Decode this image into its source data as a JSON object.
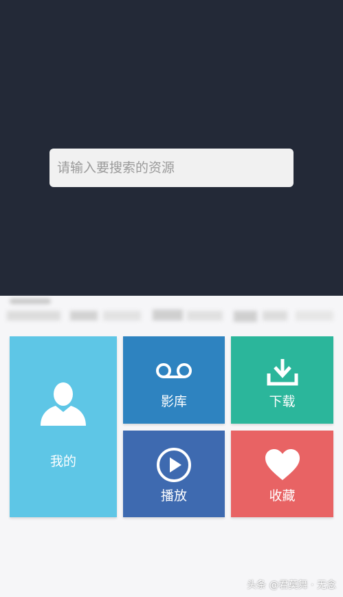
{
  "search": {
    "placeholder": "请输入要搜索的资源"
  },
  "tiles": {
    "mine": {
      "label": "我的",
      "icon": "user-icon",
      "color": "#5ec6e6"
    },
    "library": {
      "label": "影库",
      "icon": "voicemail-icon",
      "color": "#2e83c0"
    },
    "download": {
      "label": "下载",
      "icon": "download-icon",
      "color": "#2bb69b"
    },
    "play": {
      "label": "播放",
      "icon": "play-icon",
      "color": "#3e6ab0"
    },
    "favorites": {
      "label": "收藏",
      "icon": "heart-icon",
      "color": "#e86364"
    }
  },
  "colors": {
    "top_panel": "#232937",
    "background": "#f6f6f8"
  },
  "watermark": "头条 @君莫舞 · 无念"
}
